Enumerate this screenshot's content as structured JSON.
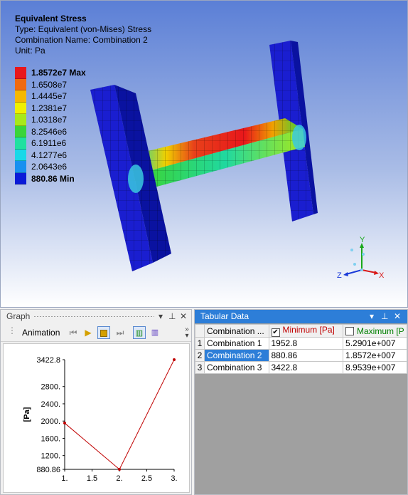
{
  "result": {
    "title": "Equivalent Stress",
    "type_line": "Type: Equivalent (von-Mises) Stress",
    "combination_line": "Combination Name: Combination 2",
    "unit_line": "Unit: Pa"
  },
  "legend": [
    {
      "label": "1.8572e7 Max",
      "color": "#e8171b",
      "bold": true
    },
    {
      "label": "1.6508e7",
      "color": "#f06a10",
      "bold": false
    },
    {
      "label": "1.4445e7",
      "color": "#f5b800",
      "bold": false
    },
    {
      "label": "1.2381e7",
      "color": "#f0f000",
      "bold": false
    },
    {
      "label": "1.0318e7",
      "color": "#a8e81a",
      "bold": false
    },
    {
      "label": "8.2546e6",
      "color": "#3ad43a",
      "bold": false
    },
    {
      "label": "6.1911e6",
      "color": "#20e0a0",
      "bold": false
    },
    {
      "label": "4.1277e6",
      "color": "#18d8e8",
      "bold": false
    },
    {
      "label": "2.0643e6",
      "color": "#1890f0",
      "bold": false
    },
    {
      "label": "880.86 Min",
      "color": "#0a1ad8",
      "bold": true
    }
  ],
  "triad": {
    "y": "Y",
    "z": "Z",
    "x": "X"
  },
  "graph_panel": {
    "title": "Graph",
    "pin_icon": "pin-icon",
    "close_label": "✕",
    "animation_label": "Animation"
  },
  "tabular_panel": {
    "title": "Tabular Data",
    "close_label": "✕",
    "columns": [
      "Combination ...",
      "Minimum [Pa]",
      "Maximum [P"
    ],
    "minimum_checked": true,
    "maximum_checked": false,
    "rows": [
      {
        "num": "1",
        "name": "Combination 1",
        "min": "1952.8",
        "max": "5.2901e+007"
      },
      {
        "num": "2",
        "name": "Combination 2",
        "min": "880.86",
        "max": "1.8572e+007"
      },
      {
        "num": "3",
        "name": "Combination 3",
        "min": "3422.8",
        "max": "8.9539e+007"
      }
    ],
    "selected_row": 1
  },
  "colors": {
    "accent": "#2d7ed8",
    "minimum_header": "#c00000",
    "maximum_header": "#008000",
    "graph_line": "#c00000"
  },
  "chart_data": {
    "type": "line",
    "x": [
      1,
      2,
      3
    ],
    "values": [
      1952.8,
      880.86,
      3422.8
    ],
    "ylabel": "[Pa]",
    "xlabel": "",
    "xlim": [
      1,
      3
    ],
    "ylim": [
      880.86,
      3422.8
    ],
    "x_ticks": [
      "1.",
      "1.5",
      "2.",
      "2.5",
      "3."
    ],
    "x_tick_values": [
      1,
      1.5,
      2,
      2.5,
      3
    ],
    "y_ticks": [
      "880.86",
      "1200.",
      "1600.",
      "2000.",
      "2400.",
      "2800.",
      "3422.8"
    ],
    "y_tick_values": [
      880.86,
      1200,
      1600,
      2000,
      2400,
      2800,
      3422.8
    ],
    "grid": false
  }
}
